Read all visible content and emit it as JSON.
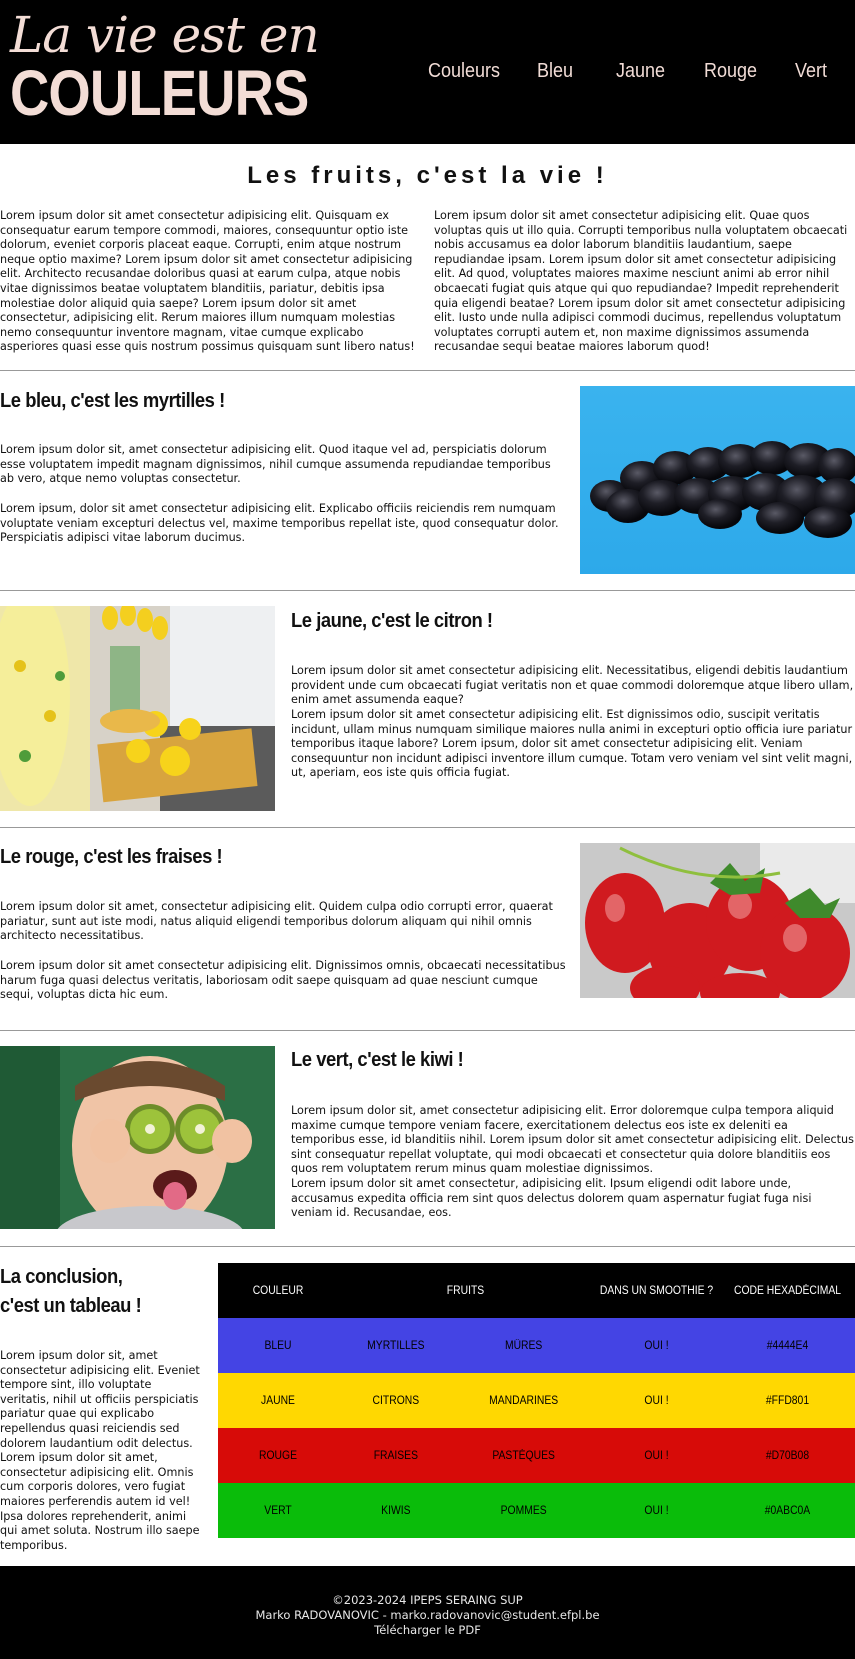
{
  "header": {
    "logo_top": "La vie est en",
    "logo_bottom": "COULEURS",
    "nav": [
      "Couleurs",
      "Bleu",
      "Jaune",
      "Rouge",
      "Vert"
    ]
  },
  "intro": {
    "title": "Les fruits, c'est la vie !",
    "col1": "Lorem ipsum dolor sit amet consectetur adipisicing elit. Quisquam ex consequatur earum tempore commodi, maiores, consequuntur optio iste dolorum, eveniet corporis placeat eaque. Corrupti, enim atque nostrum neque optio maxime? Lorem ipsum dolor sit amet consectetur adipisicing elit. Architecto recusandae doloribus quasi at earum culpa, atque nobis vitae dignissimos beatae voluptatem blanditiis, pariatur, debitis ipsa molestiae dolor aliquid quia saepe? Lorem ipsum dolor sit amet consectetur, adipisicing elit. Rerum maiores illum numquam molestias nemo consequuntur inventore magnam, vitae cumque explicabo asperiores quasi esse quis nostrum possimus quisquam sunt libero natus!",
    "col2": "Lorem ipsum dolor sit amet consectetur adipisicing elit. Quae quos voluptas quis ut illo quia. Corrupti temporibus nulla voluptatem obcaecati nobis accusamus ea dolor laborum blanditiis laudantium, saepe repudiandae ipsam. Lorem ipsum dolor sit amet consectetur adipisicing elit. Ad quod, voluptates maiores maxime nesciunt animi ab error nihil obcaecati fugiat quis atque qui quo repudiandae? Impedit reprehenderit quia eligendi beatae? Lorem ipsum dolor sit amet consectetur adipisicing elit. Iusto unde nulla adipisci commodi ducimus, repellendus voluptatum voluptates corrupti autem et, non maxime dignissimos assumenda recusandae sequi beatae maiores laborum quod!"
  },
  "bleu": {
    "title": "Le bleu, c'est les myrtilles !",
    "p1": "Lorem ipsum dolor sit, amet consectetur adipisicing elit. Quod itaque vel ad, perspiciatis dolorum esse voluptatem impedit magnam dignissimos, nihil cumque assumenda repudiandae temporibus ab vero, atque nemo voluptas consectetur.",
    "p2": "Lorem ipsum, dolor sit amet consectetur adipisicing elit. Explicabo officiis reiciendis rem numquam voluptate veniam excepturi delectus vel, maxime temporibus repellat iste, quod consequatur dolor. Perspiciatis adipisci vitae laborum ducimus."
  },
  "jaune": {
    "title": "Le jaune, c'est le citron !",
    "p1": "Lorem ipsum dolor sit amet consectetur adipisicing elit. Necessitatibus, eligendi debitis laudantium provident unde cum obcaecati fugiat veritatis non et quae commodi doloremque atque libero ullam, enim amet assumenda eaque?",
    "p2": "Lorem ipsum dolor sit amet consectetur adipisicing elit. Est dignissimos odio, suscipit veritatis incidunt, ullam minus numquam similique maiores nulla animi in excepturi optio officia iure pariatur temporibus itaque labore? Lorem ipsum, dolor sit amet consectetur adipisicing elit. Veniam consequuntur non incidunt adipisci inventore illum cumque. Totam vero veniam vel sint velit magni, ut, aperiam, eos iste quis officia fugiat."
  },
  "rouge": {
    "title": "Le rouge, c'est les fraises !",
    "p1": "Lorem ipsum dolor sit amet, consectetur adipisicing elit. Quidem culpa odio corrupti error, quaerat pariatur, sunt aut iste modi, natus aliquid eligendi temporibus dolorum aliquam qui nihil omnis architecto necessitatibus.",
    "p2": "Lorem ipsum dolor sit amet consectetur adipisicing elit. Dignissimos omnis, obcaecati necessitatibus harum fuga quasi delectus veritatis, laboriosam odit saepe quisquam ad quae nesciunt cumque sequi, voluptas dicta hic eum."
  },
  "vert": {
    "title": "Le vert, c'est le kiwi !",
    "p1": "Lorem ipsum dolor sit, amet consectetur adipisicing elit. Error doloremque culpa tempora aliquid maxime cumque tempore veniam facere, exercitationem delectus eos iste ex deleniti ea temporibus esse, id blanditiis nihil. Lorem ipsum dolor sit amet consectetur adipisicing elit. Delectus sint consequatur repellat voluptate, qui modi obcaecati et consectetur quia dolore blanditiis eos quos rem voluptatem rerum minus quam molestiae dignissimos.",
    "p2": "Lorem ipsum dolor sit amet consectetur, adipisicing elit. Ipsum eligendi odit labore unde, accusamus expedita officia rem sint quos delectus dolorem quam aspernatur fugiat fuga nisi veniam id. Recusandae, eos."
  },
  "conclusion": {
    "title1": "La conclusion,",
    "title2": "c'est un tableau !",
    "text": "Lorem ipsum dolor sit, amet consectetur adipisicing elit. Eveniet tempore sint, illo voluptate veritatis, nihil ut officiis perspiciatis pariatur quae qui explicabo repellendus quasi reiciendis sed dolorem laudantium odit delectus. Lorem ipsum dolor sit amet, consectetur adipisicing elit. Omnis cum corporis dolores, vero fugiat maiores perferendis autem id vel! Ipsa dolores reprehenderit, animi qui amet soluta. Nostrum illo saepe temporibus."
  },
  "table": {
    "headers": [
      "COULEUR",
      "FRUITS",
      "DANS UN SMOOTHIE ?",
      "CODE HEXADÉCIMAL"
    ],
    "rows": [
      {
        "couleur": "BLEU",
        "fruit1": "MYRTILLES",
        "fruit2": "MÛRES",
        "smoothie": "OUI !",
        "hex": "#4444E4",
        "bg": "#4444E4",
        "fg": "#000000"
      },
      {
        "couleur": "JAUNE",
        "fruit1": "CITRONS",
        "fruit2": "MANDARINES",
        "smoothie": "OUI !",
        "hex": "#FFD801",
        "bg": "#FFD801",
        "fg": "#000000"
      },
      {
        "couleur": "ROUGE",
        "fruit1": "FRAISES",
        "fruit2": "PASTÈQUES",
        "smoothie": "OUI !",
        "hex": "#D70B08",
        "bg": "#D70B08",
        "fg": "#000000"
      },
      {
        "couleur": "VERT",
        "fruit1": "KIWIS",
        "fruit2": "POMMES",
        "smoothie": "OUI !",
        "hex": "#0ABC0A",
        "bg": "#0ABC0A",
        "fg": "#000000"
      }
    ]
  },
  "footer": {
    "copyright": "©2023-2024 IPEPS SERAING SUP",
    "author": "Marko RADOVANOVIC - marko.radovanovic@student.efpl.be",
    "pdf": "Télécharger le PDF"
  },
  "colors": {
    "header_bg": "#000000",
    "logo": "#F3DDD6",
    "separator": "#999999"
  }
}
